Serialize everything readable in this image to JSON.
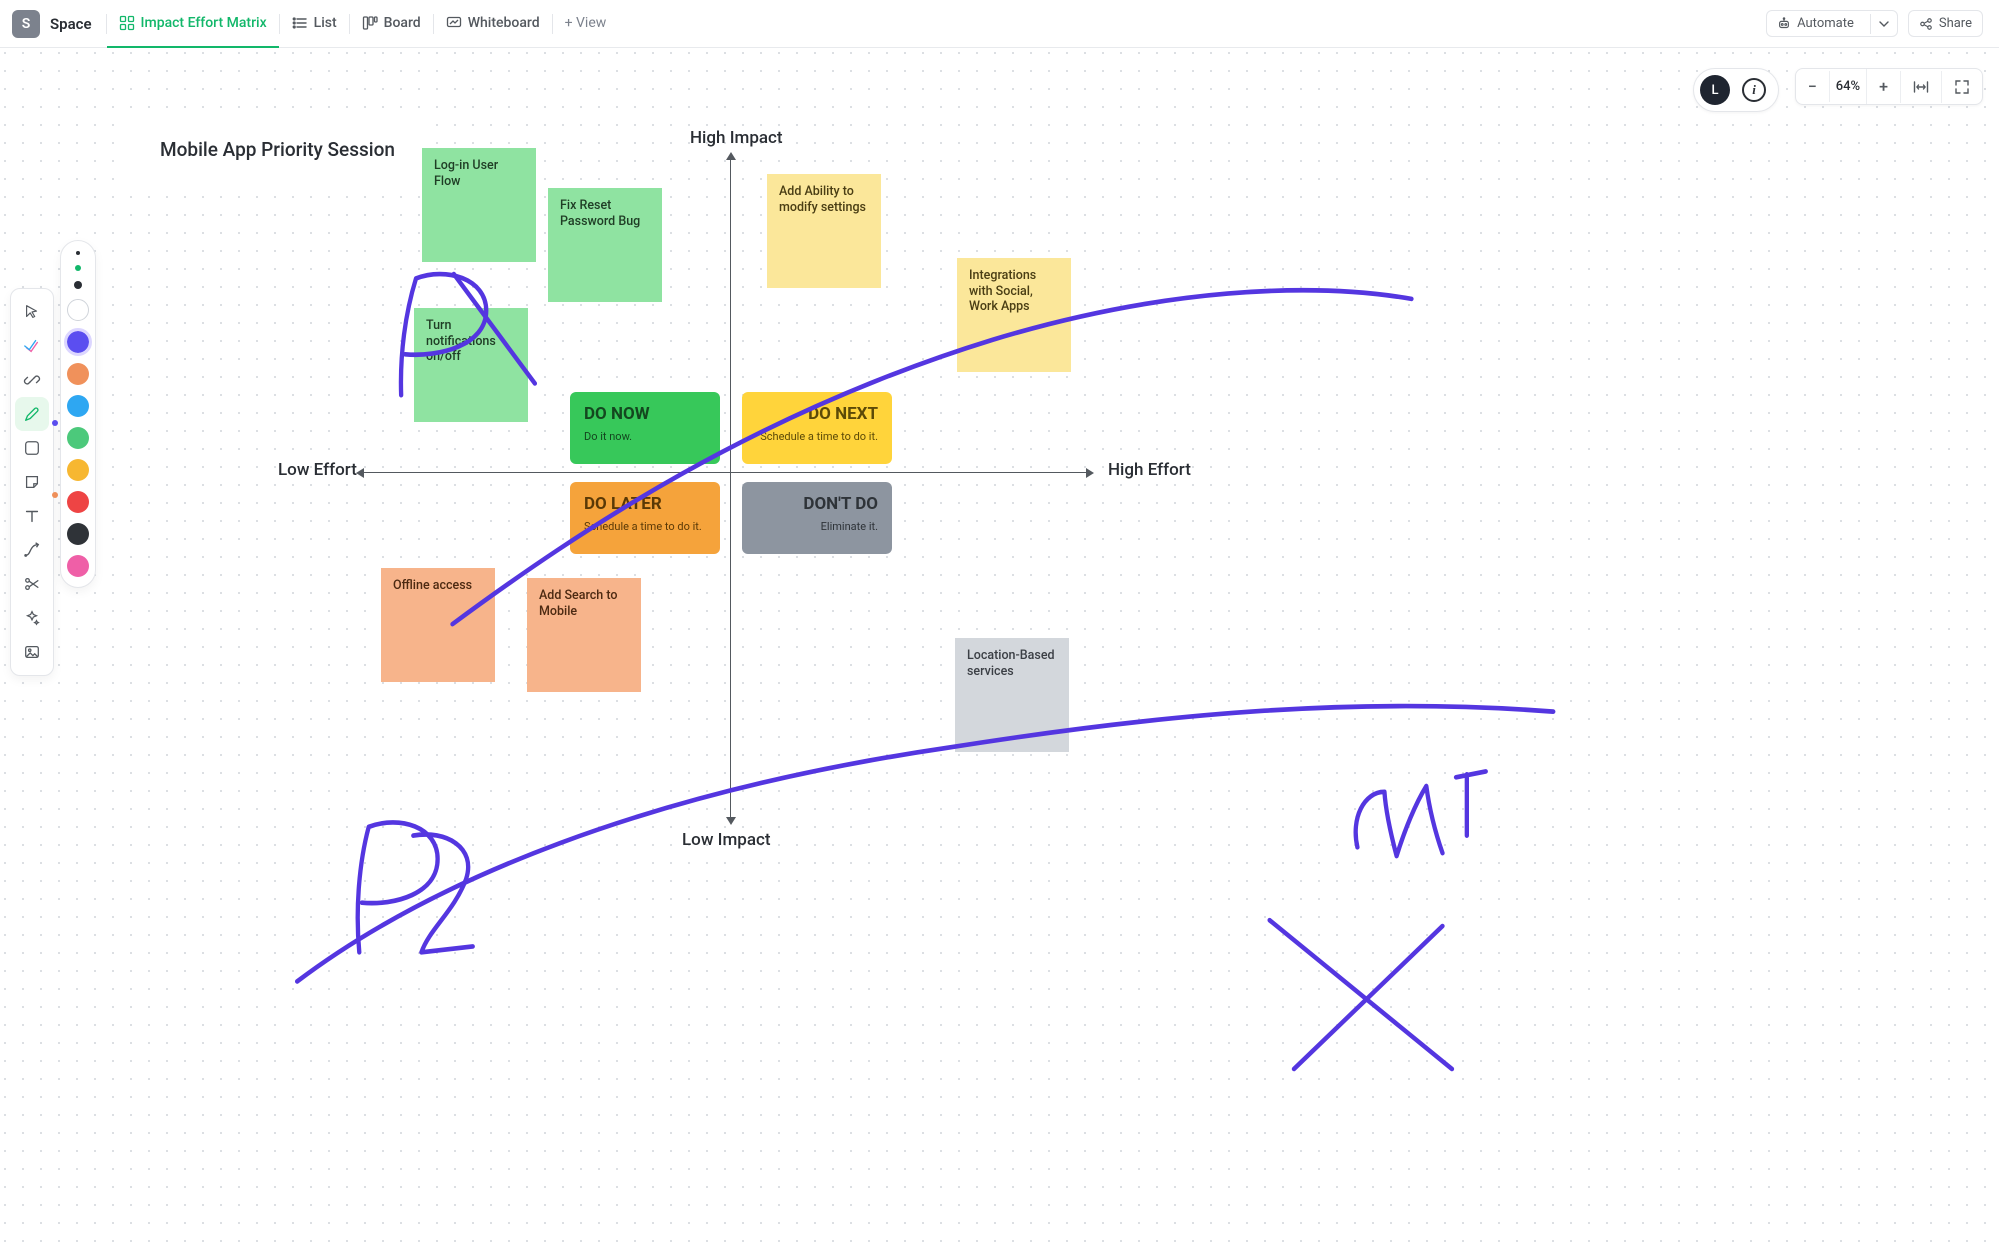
{
  "workspace": {
    "badge_letter": "S",
    "name": "Space"
  },
  "views": {
    "active": "Impact Effort Matrix",
    "list": "List",
    "board": "Board",
    "whiteboard": "Whiteboard",
    "add": "+ View"
  },
  "toolbar_top": {
    "automate": "Automate",
    "share": "Share"
  },
  "collab": {
    "avatar": "L",
    "info_glyph": "i"
  },
  "zoom": {
    "value": "64%"
  },
  "main_tools": {
    "select": "select",
    "task": "task",
    "link": "link",
    "pen": "pen",
    "square": "square",
    "sticky": "sticky",
    "text": "text",
    "connector": "connector",
    "scissors": "scissors",
    "magic": "magic",
    "image": "image"
  },
  "palette": {
    "colors": {
      "white": "#ffffff",
      "purple": "#5b4ef0",
      "orange": "#f0915b",
      "blue": "#2ea7f2",
      "green": "#4cc97b",
      "amber": "#f7b731",
      "red": "#ee4444",
      "charcoal": "#2f3338",
      "pink": "#ef5fa7"
    },
    "selected": "purple"
  },
  "board": {
    "title": "Mobile App Priority Session",
    "axes": {
      "top": "High Impact",
      "bottom": "Low Impact",
      "left": "Low Effort",
      "right": "High Effort"
    },
    "quadrants": {
      "do_now": {
        "heading": "DO NOW",
        "sub": "Do it now."
      },
      "do_next": {
        "heading": "DO NEXT",
        "sub": "Schedule a time to do it."
      },
      "do_later": {
        "heading": "DO LATER",
        "sub": "Schedule a time to do it."
      },
      "dont_do": {
        "heading": "DON'T DO",
        "sub": "Eliminate it."
      }
    },
    "notes": {
      "login": {
        "text": "Log-in User Flow",
        "color": "green"
      },
      "reset_pw": {
        "text": "Fix Reset Password Bug",
        "color": "green"
      },
      "notifications": {
        "text": "Turn notifications on/off",
        "color": "green"
      },
      "settings": {
        "text": "Add Ability to modify settings",
        "color": "yellow"
      },
      "integrations": {
        "text": "Integrations with Social, Work Apps",
        "color": "yellow"
      },
      "offline": {
        "text": "Offline access",
        "color": "orange"
      },
      "search": {
        "text": "Add Search to Mobile",
        "color": "orange"
      },
      "location": {
        "text": "Location-Based services",
        "color": "gray"
      }
    },
    "handwriting": {
      "p1": "P1",
      "p2": "P2",
      "cut": "Cut"
    }
  }
}
